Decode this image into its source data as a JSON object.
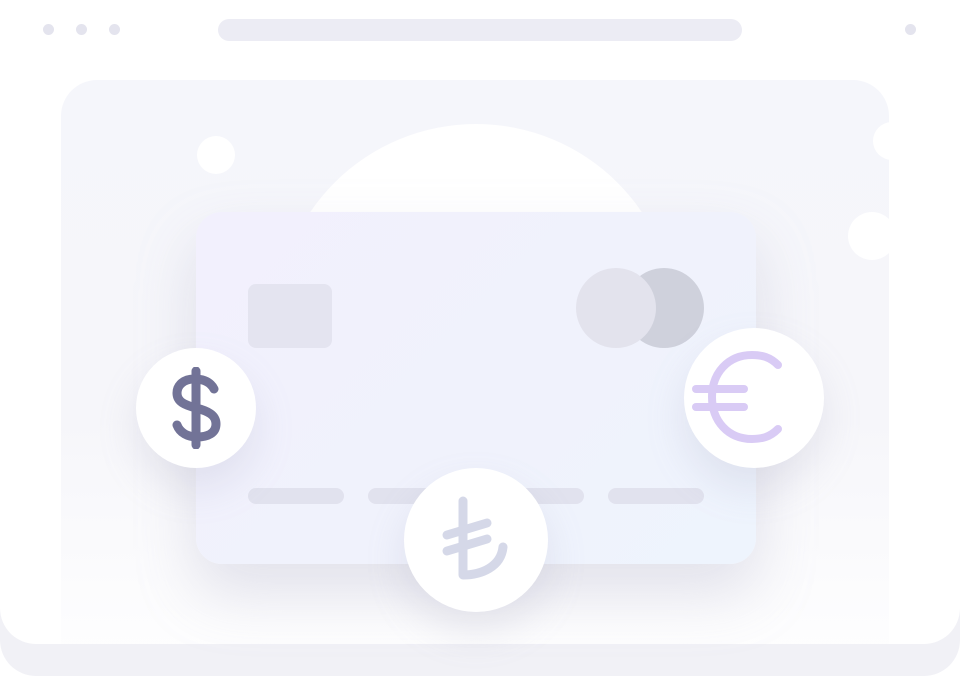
{
  "window": {
    "control_dots": [
      "window-dot",
      "window-dot",
      "window-dot"
    ],
    "address_bar": ""
  },
  "illustration": {
    "card": {
      "chip": "card-chip",
      "network_logo": "card-network-logo",
      "number_groups": 4
    },
    "currency_icons": [
      {
        "name": "dollar-icon",
        "symbol": "$",
        "color": "#727397"
      },
      {
        "name": "euro-icon",
        "symbol": "€",
        "color": "#d9cbf5"
      },
      {
        "name": "lira-icon",
        "symbol": "₺",
        "color": "#d5d8e8"
      }
    ]
  },
  "colors": {
    "background": "#ffffff",
    "panel": "#f5f6fb",
    "card": "#f1f1fc",
    "dot": "#e4e4ee",
    "dollar": "#727397",
    "euro": "#d9cbf5",
    "lira": "#d5d8e8"
  }
}
